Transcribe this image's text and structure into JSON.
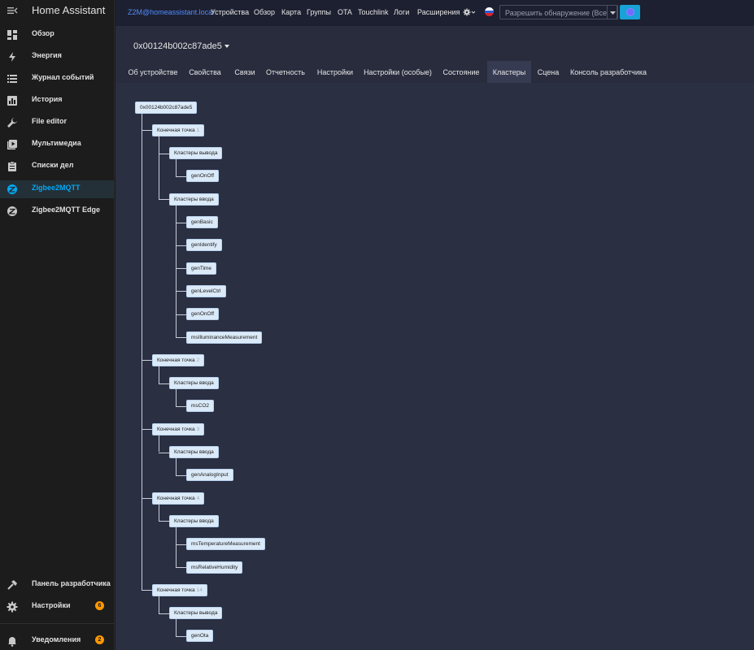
{
  "sidebar": {
    "title": "Home Assistant",
    "items": [
      {
        "label": "Обзор"
      },
      {
        "label": "Энергия"
      },
      {
        "label": "Журнал событий"
      },
      {
        "label": "История"
      },
      {
        "label": "File editor"
      },
      {
        "label": "Мультимедиа"
      },
      {
        "label": "Списки дел"
      },
      {
        "label": "Zigbee2MQTT",
        "active": true
      },
      {
        "label": "Zigbee2MQTT Edge"
      }
    ],
    "bottom": [
      {
        "label": "Панель разработчика"
      },
      {
        "label": "Настройки",
        "badge": "6"
      },
      {
        "label": "Уведомления",
        "badge": "2"
      }
    ]
  },
  "topbar": {
    "brand": "Z2M@homeassistant.local",
    "links": [
      "Устройства",
      "Обзор",
      "Карта",
      "Группы",
      "OTA",
      "Touchlink",
      "Логи",
      "Расширения"
    ],
    "permit_join": "Разрешить обнаружение (Все)"
  },
  "device": {
    "title": "0x00124b002c87ade5"
  },
  "tabs": [
    "Об устройстве",
    "Свойства",
    "Связи",
    "Отчетность",
    "Настройки",
    "Настройки (особые)",
    "Состояние",
    "Кластеры",
    "Сцена",
    "Консоль разработчика"
  ],
  "active_tab": "Кластеры",
  "tree": {
    "root": "0x00124b002c87ade5",
    "endpoint_label": "Конечная точка",
    "output_label": "Кластеры вывода",
    "input_label": "Кластеры ввода",
    "endpoints": [
      {
        "id": "1",
        "output": [
          "genOnOff"
        ],
        "input": [
          "genBasic",
          "genIdentify",
          "genTime",
          "genLevelCtrl",
          "genOnOff",
          "msIlluminanceMeasurement"
        ]
      },
      {
        "id": "2",
        "input": [
          "msCO2"
        ]
      },
      {
        "id": "3",
        "input": [
          "genAnalogInput"
        ]
      },
      {
        "id": "4",
        "input": [
          "msTemperatureMeasurement",
          "msRelativeHumidity"
        ]
      },
      {
        "id": "14",
        "output": [
          "genOta"
        ]
      }
    ]
  }
}
